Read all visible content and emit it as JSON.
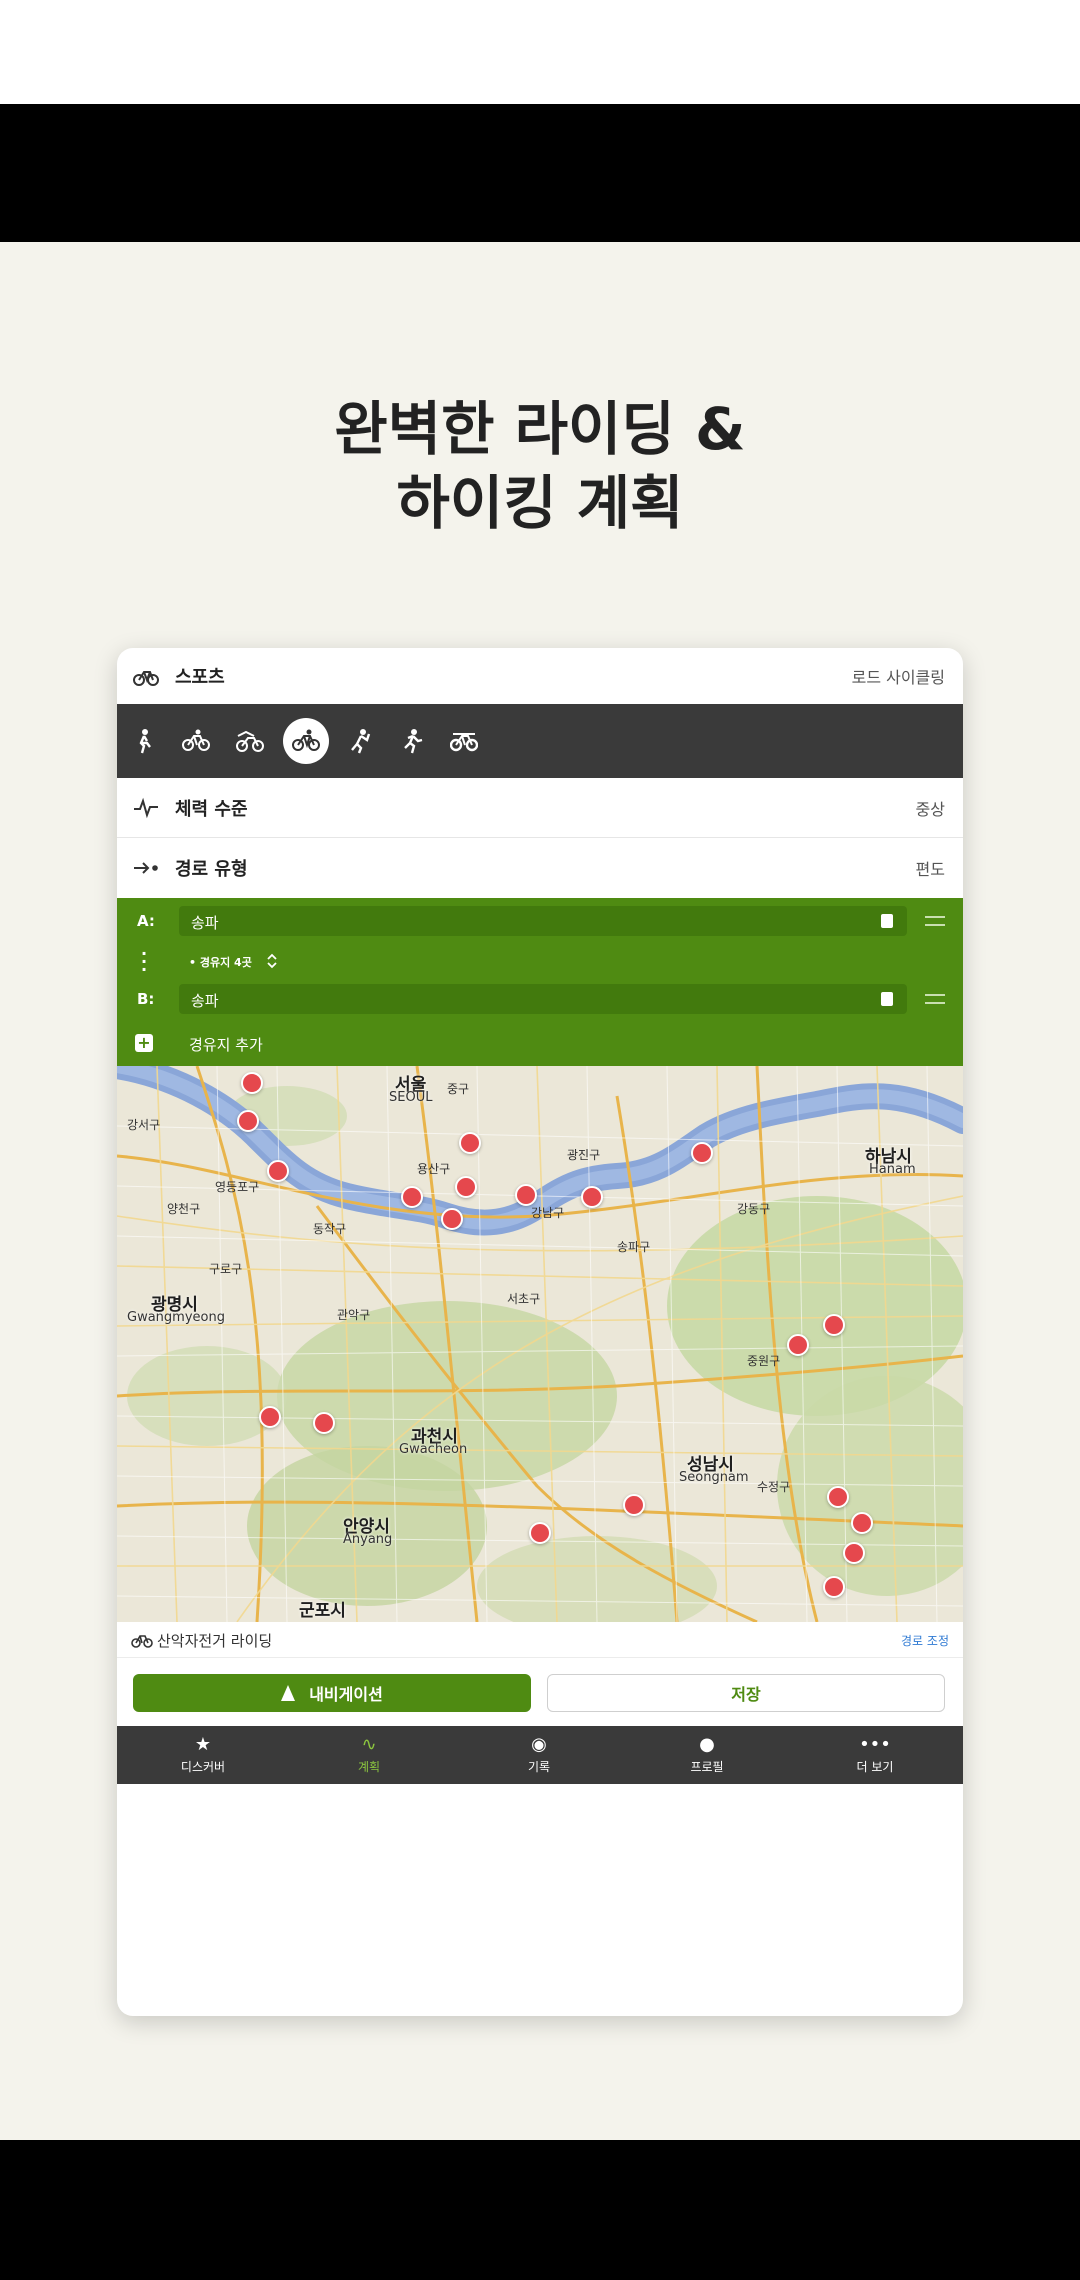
{
  "headline": {
    "line1": "완벽한 라이딩 &",
    "line2": "하이킹 계획"
  },
  "sport": {
    "label": "스포츠",
    "value": "로드 사이클링"
  },
  "activities": [
    {
      "icon": "hiking-icon"
    },
    {
      "icon": "bike-icon"
    },
    {
      "icon": "mtb-icon"
    },
    {
      "icon": "road-bike-icon",
      "selected": true
    },
    {
      "icon": "mountaineering-icon"
    },
    {
      "icon": "running-icon"
    },
    {
      "icon": "gravel-bike-icon"
    }
  ],
  "fitness": {
    "label": "체력 수준",
    "value": "중상"
  },
  "route_type": {
    "label": "경로 유형",
    "value": "편도"
  },
  "waypoints": {
    "a_key": "A:",
    "a_value": "송파",
    "via": "• 경유지 4곳",
    "b_key": "B:",
    "b_value": "송파",
    "add_label": "경유지 추가"
  },
  "map": {
    "labels": {
      "seoul": "서울",
      "seoul_en": "SEOUL",
      "hanam": "하남시",
      "hanam_en": "Hanam",
      "gwangmyeong": "광명시",
      "gwangmyeong_en": "Gwangmyeong",
      "gwacheon": "과천시",
      "gwacheon_en": "Gwacheon",
      "seongnam": "성남시",
      "seongnam_en": "Seongnam",
      "anyang": "안양시",
      "anyang_en": "Anyang",
      "gunpo": "군포시",
      "gwangjingu": "광진구",
      "gangdonggu": "강동구",
      "gangnamgu": "강남구",
      "seochogu": "서초구",
      "songpagu": "송파구",
      "yongsangu": "용산구",
      "guro": "구로구",
      "gwanak": "관악구",
      "yeongdeungpo": "영등포구",
      "gangseo": "강서구",
      "yangcheon": "양천구",
      "dongjak": "동작구",
      "junggu": "중구",
      "sujeong": "수정구",
      "jungwon": "중원구"
    }
  },
  "routebar": {
    "label": "산악자전거 라이딩",
    "link": "경로 조정"
  },
  "buttons": {
    "navigate": "내비게이션",
    "save": "저장"
  },
  "tabs": [
    {
      "label": "디스커버",
      "icon": "★"
    },
    {
      "label": "계획",
      "icon": "∿",
      "active": true
    },
    {
      "label": "기록",
      "icon": "◉"
    },
    {
      "label": "프로필",
      "icon": "●"
    },
    {
      "label": "더 보기",
      "icon": "•••"
    }
  ],
  "colors": {
    "green": "#4f8b12",
    "dark_bar": "#3a3a3a",
    "pin": "#e5484d",
    "background": "#f4f3ec"
  }
}
